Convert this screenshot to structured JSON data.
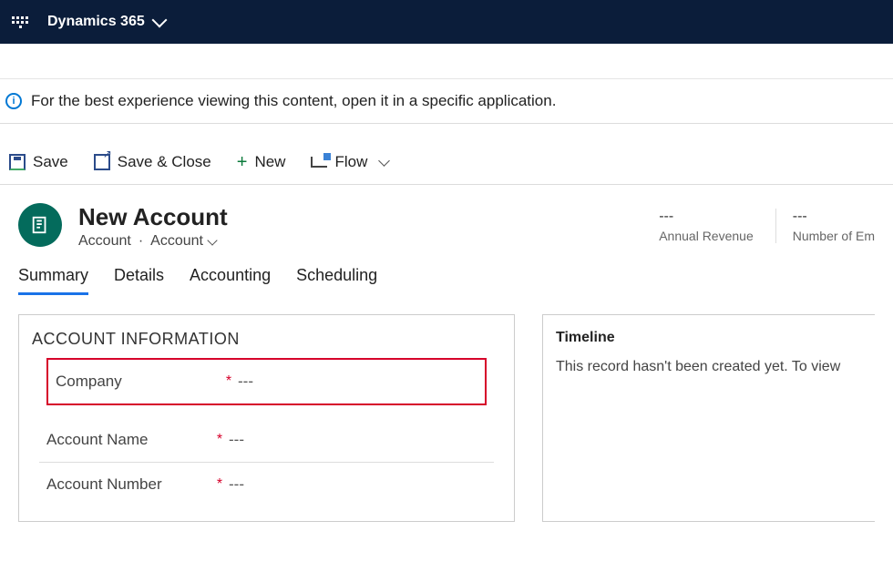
{
  "topbar": {
    "brand": "Dynamics 365"
  },
  "notice": {
    "text": "For the best experience viewing this content, open it in a specific application."
  },
  "commands": {
    "save": "Save",
    "save_close": "Save & Close",
    "new": "New",
    "flow": "Flow"
  },
  "header": {
    "title": "New Account",
    "entity": "Account",
    "form": "Account"
  },
  "stats": [
    {
      "value": "---",
      "label": "Annual Revenue"
    },
    {
      "value": "---",
      "label": "Number of Em"
    }
  ],
  "tabs": [
    "Summary",
    "Details",
    "Accounting",
    "Scheduling"
  ],
  "section": {
    "title": "ACCOUNT INFORMATION"
  },
  "fields": {
    "company": {
      "label": "Company",
      "value": "---"
    },
    "account_name": {
      "label": "Account Name",
      "value": "---"
    },
    "account_number": {
      "label": "Account Number",
      "value": "---"
    }
  },
  "timeline": {
    "title": "Timeline",
    "message": "This record hasn't been created yet.  To view "
  }
}
